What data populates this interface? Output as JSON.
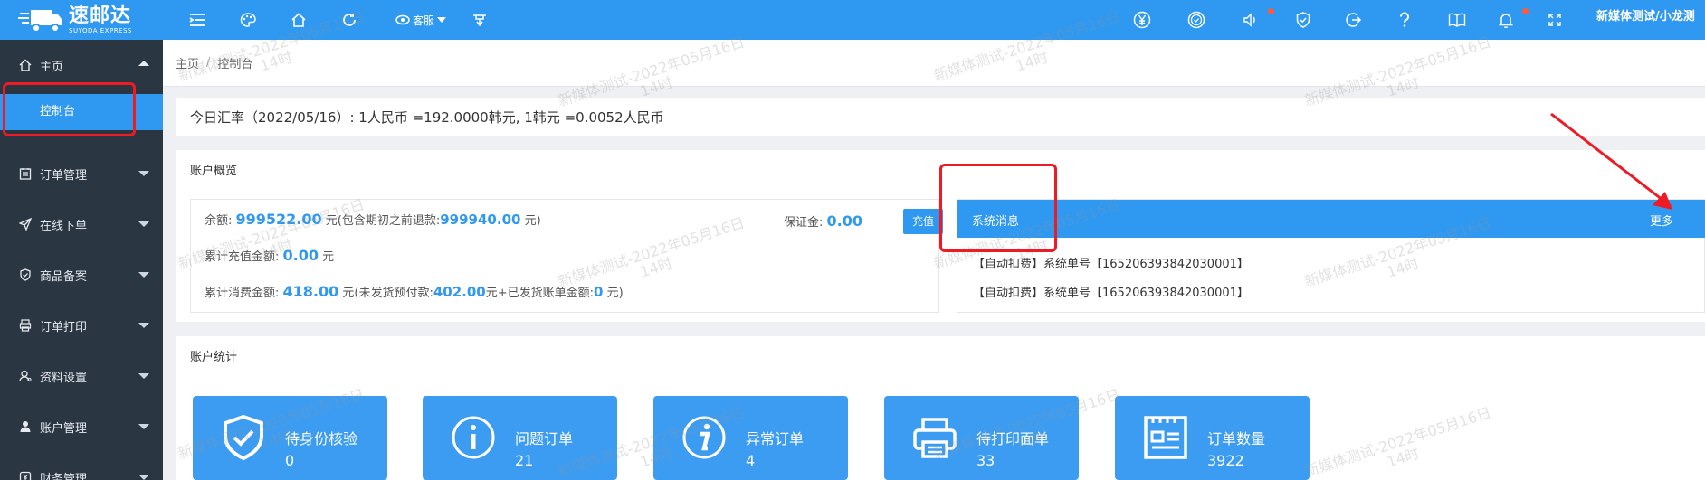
{
  "brand": {
    "name_cn": "速邮达",
    "name_en": "SUYODA EXPRESS"
  },
  "topbar": {
    "customer_service": "客服",
    "user": "新媒体测试/小龙测"
  },
  "sidebar": {
    "items": [
      {
        "label": "主页",
        "icon": "home-icon",
        "expanded": true
      },
      {
        "label": "订单管理",
        "icon": "order-icon"
      },
      {
        "label": "在线下单",
        "icon": "send-icon"
      },
      {
        "label": "商品备案",
        "icon": "shield-icon"
      },
      {
        "label": "订单打印",
        "icon": "printer-icon"
      },
      {
        "label": "资料设置",
        "icon": "settings-icon"
      },
      {
        "label": "账户管理",
        "icon": "user-icon"
      },
      {
        "label": "财务管理",
        "icon": "finance-icon"
      }
    ],
    "active_sub": "控制台"
  },
  "breadcrumb": {
    "home": "主页",
    "separator": "/",
    "current": "控制台"
  },
  "rate": {
    "text": "今日汇率（2022/05/16）: 1人民币 =192.0000韩元, 1韩元 =0.0052人民币"
  },
  "overview": {
    "title": "账户概览",
    "balance_label": "余额: ",
    "balance_value": "999522.00",
    "balance_suffix": " 元(包含期初之前退款:",
    "refund_value": "999940.00",
    "refund_suffix": " 元)",
    "deposit_label": "保证金: ",
    "deposit_value": "0.00",
    "recharge_button": "充值",
    "total_recharge_label": "累计充值金额: ",
    "total_recharge_value": "0.00",
    "total_recharge_suffix": " 元",
    "total_consume_label": "累计消费金额: ",
    "total_consume_value": "418.00",
    "total_consume_mid": " 元(未发货预付款:",
    "prepaid_value": "402.00",
    "prepaid_mid": "元+已发货账单金额:",
    "billed_value": "0",
    "billed_suffix": " 元)"
  },
  "messages": {
    "title": "系统消息",
    "more": "更多",
    "items": [
      "【自动扣费】系统单号【165206393842030001】",
      "【自动扣费】系统单号【165206393842030001】"
    ]
  },
  "stats": {
    "title": "账户统计",
    "cards": [
      {
        "label": "待身份核验",
        "value": "0",
        "icon": "verify-shield-icon"
      },
      {
        "label": "问题订单",
        "value": "21",
        "icon": "info-circle-icon"
      },
      {
        "label": "异常订单",
        "value": "4",
        "icon": "info-italic-icon"
      },
      {
        "label": "待打印面单",
        "value": "33",
        "icon": "printer-icon"
      },
      {
        "label": "订单数量",
        "value": "3922",
        "icon": "document-list-icon"
      }
    ]
  },
  "watermark": {
    "line1": "新媒体测试-2022年05月16日",
    "line2": "14时"
  },
  "colors": {
    "primary": "#2f98f0",
    "sidebar": "#2b3643",
    "annotation": "#ee1b24"
  }
}
